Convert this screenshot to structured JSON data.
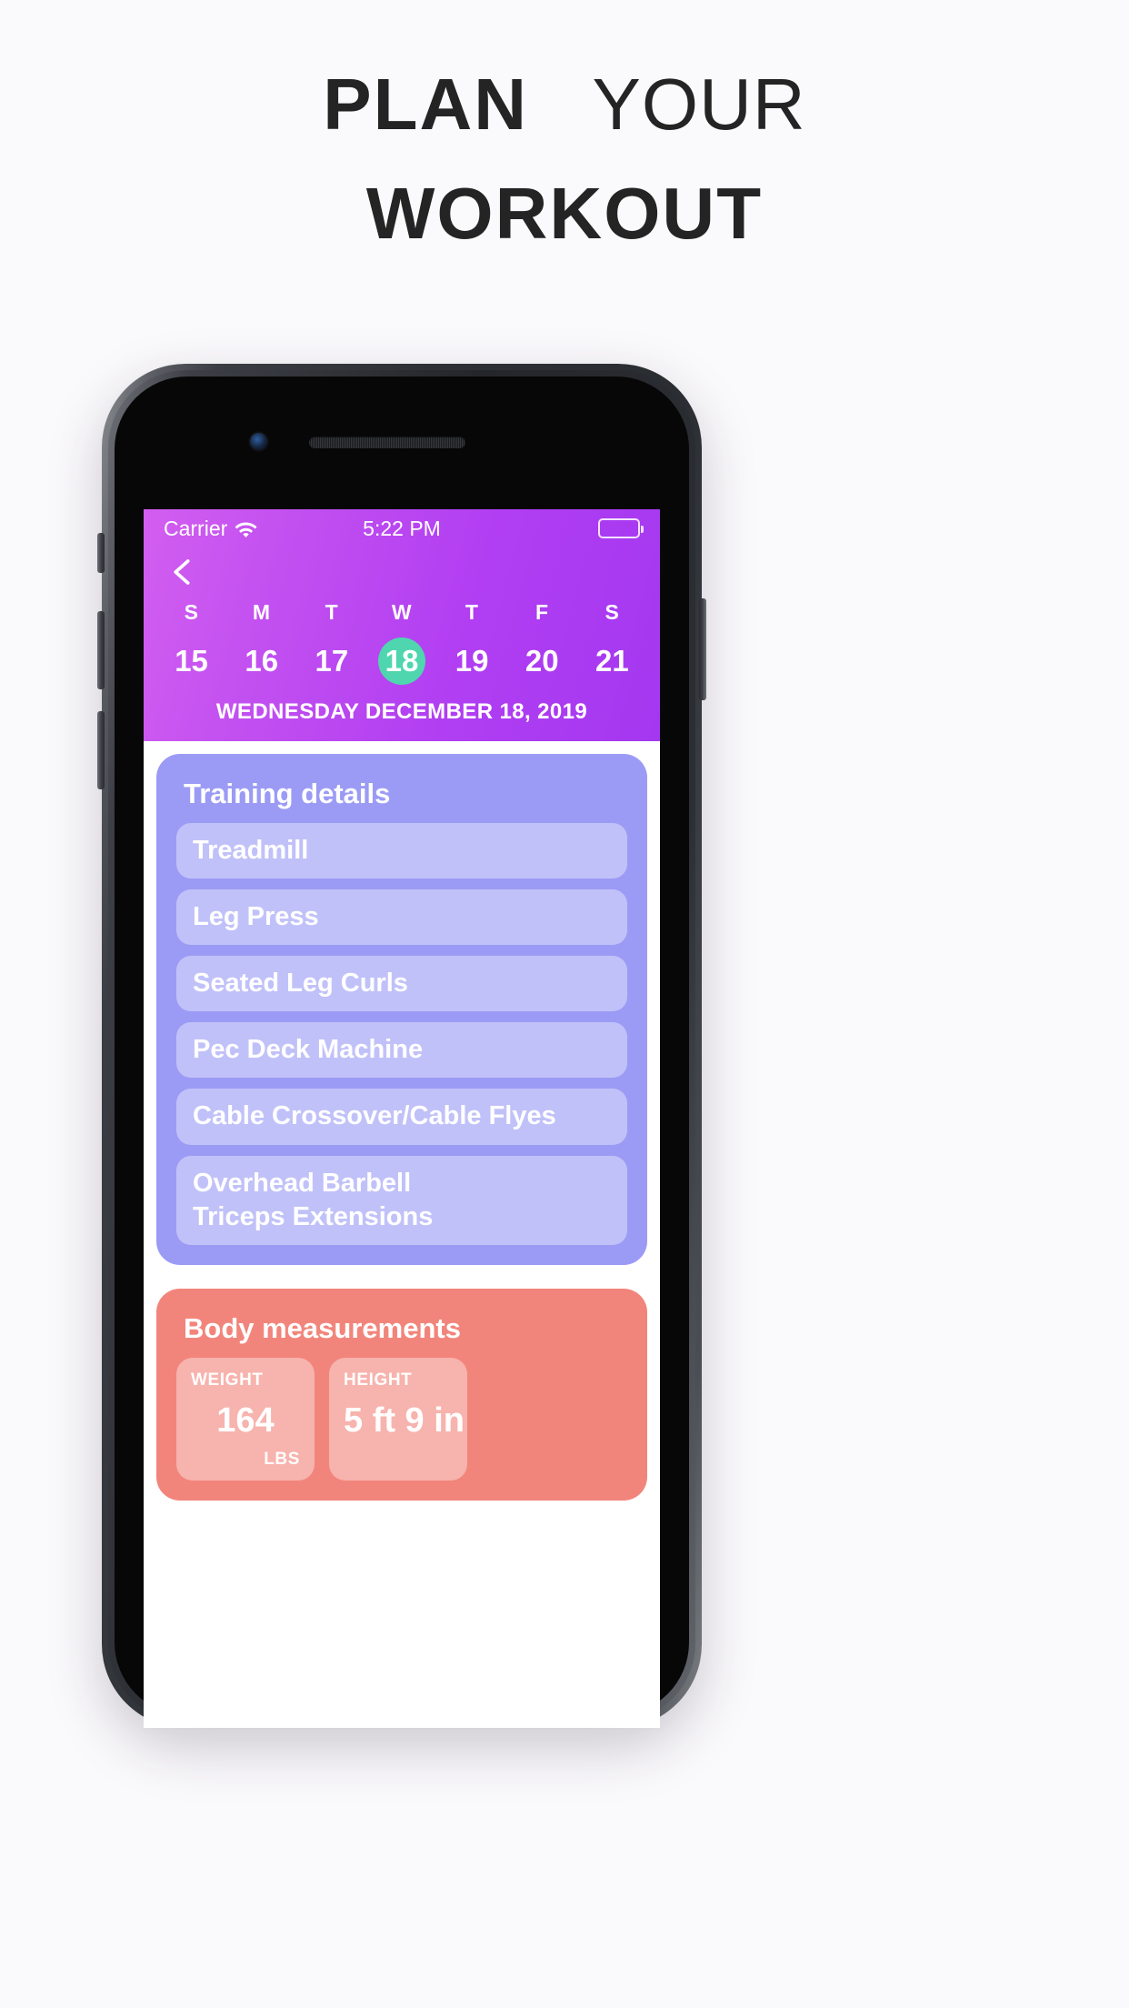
{
  "marketing": {
    "headline_line1_strong": "PLAN",
    "headline_line1_light": "YOUR",
    "headline_line2": "WORKOUT"
  },
  "status_bar": {
    "carrier": "Carrier",
    "wifi_icon": "wifi-icon",
    "time": "5:22 PM",
    "battery_icon": "battery-full-icon"
  },
  "header": {
    "back_icon": "chevron-left-icon",
    "days_of_week": [
      "S",
      "M",
      "T",
      "W",
      "T",
      "F",
      "S"
    ],
    "dates": [
      "15",
      "16",
      "17",
      "18",
      "19",
      "20",
      "21"
    ],
    "selected_date": "18",
    "selected_index": 3,
    "full_date": "WEDNESDAY DECEMBER 18, 2019",
    "accent_selected": "#4fd6ae",
    "gradient_from": "#d25ef0",
    "gradient_to": "#a438f0"
  },
  "training_card": {
    "title": "Training details",
    "color": "#9b9bf5",
    "exercises": [
      "Treadmill",
      "Leg Press",
      "Seated Leg Curls",
      "Pec Deck Machine",
      "Cable Crossover/Cable Flyes",
      "Overhead Barbell\nTriceps Extensions"
    ]
  },
  "body_measurements_card": {
    "title": "Body measurements",
    "color": "#f2857b",
    "tiles": [
      {
        "label": "WEIGHT",
        "value": "164",
        "unit": "LBS"
      },
      {
        "label": "HEIGHT",
        "value": "5 ft 9 in",
        "unit": ""
      }
    ]
  }
}
